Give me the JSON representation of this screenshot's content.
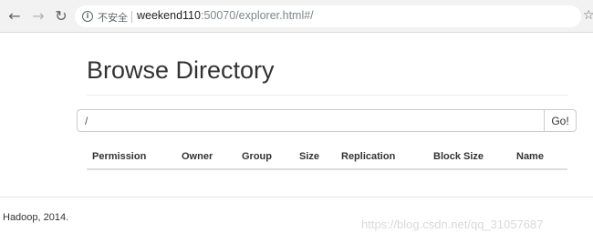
{
  "browser": {
    "security_label": "不安全",
    "url_host": "weekend110",
    "url_rest": ":50070/explorer.html#/"
  },
  "page": {
    "title": "Browse Directory",
    "path_value": "/",
    "go_label": "Go!"
  },
  "table": {
    "columns": [
      "Permission",
      "Owner",
      "Group",
      "Size",
      "Replication",
      "Block Size",
      "Name"
    ]
  },
  "footer": {
    "text": "Hadoop, 2014."
  },
  "watermark": "https://blog.csdn.net/qq_31057687"
}
